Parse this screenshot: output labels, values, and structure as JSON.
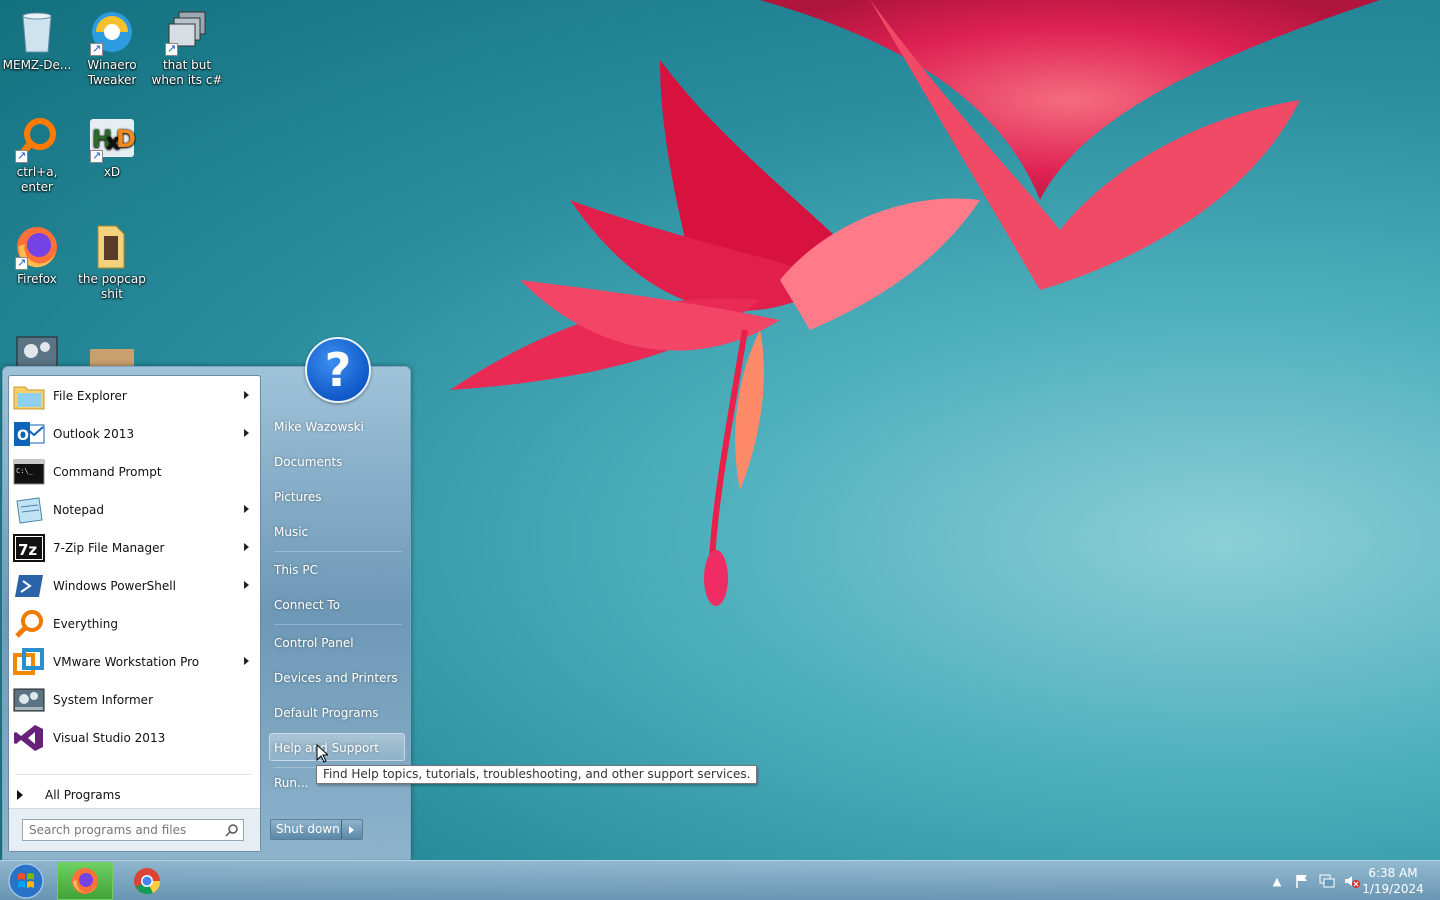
{
  "desktop": {
    "icons": [
      {
        "label": "MEMZ-De..."
      },
      {
        "label": "Winaero Tweaker"
      },
      {
        "label": "that but when its c#"
      },
      {
        "label": "ctrl+a, enter"
      },
      {
        "label": "xD"
      },
      {
        "label": "Firefox"
      },
      {
        "label": "the popcap shit"
      }
    ]
  },
  "start_menu": {
    "programs": [
      {
        "label": "File Explorer",
        "icon": "folder-icon",
        "has_submenu": true
      },
      {
        "label": "Outlook 2013",
        "icon": "outlook-icon",
        "has_submenu": true
      },
      {
        "label": "Command Prompt",
        "icon": "terminal-icon",
        "has_submenu": false
      },
      {
        "label": "Notepad",
        "icon": "notepad-icon",
        "has_submenu": true
      },
      {
        "label": "7-Zip File Manager",
        "icon": "7zip-icon",
        "has_submenu": true
      },
      {
        "label": "Windows PowerShell",
        "icon": "powershell-icon",
        "has_submenu": true
      },
      {
        "label": "Everything",
        "icon": "magnifier-icon",
        "has_submenu": false
      },
      {
        "label": "VMware Workstation Pro",
        "icon": "vmware-icon",
        "has_submenu": true
      },
      {
        "label": "System Informer",
        "icon": "system-informer-icon",
        "has_submenu": false
      },
      {
        "label": "Visual Studio 2013",
        "icon": "visual-studio-icon",
        "has_submenu": false
      }
    ],
    "all_programs_label": "All Programs",
    "search_placeholder": "Search programs and files",
    "right_links": [
      {
        "label": "Mike Wazowski"
      },
      {
        "label": "Documents"
      },
      {
        "label": "Pictures"
      },
      {
        "label": "Music"
      },
      {
        "label": "This PC"
      },
      {
        "label": "Connect To"
      },
      {
        "label": "Control Panel"
      },
      {
        "label": "Devices and Printers"
      },
      {
        "label": "Default Programs"
      },
      {
        "label": "Help and Support"
      },
      {
        "label": "Run..."
      }
    ],
    "user_picture_glyph": "?",
    "shutdown_label": "Shut down",
    "tooltip": "Find Help topics, tutorials, troubleshooting, and other support services."
  },
  "taskbar": {
    "clock_time": "6:38 AM",
    "clock_date": "1/19/2024"
  },
  "colors": {
    "accent": "#1059c9",
    "taskbar_active": "#40a336"
  }
}
